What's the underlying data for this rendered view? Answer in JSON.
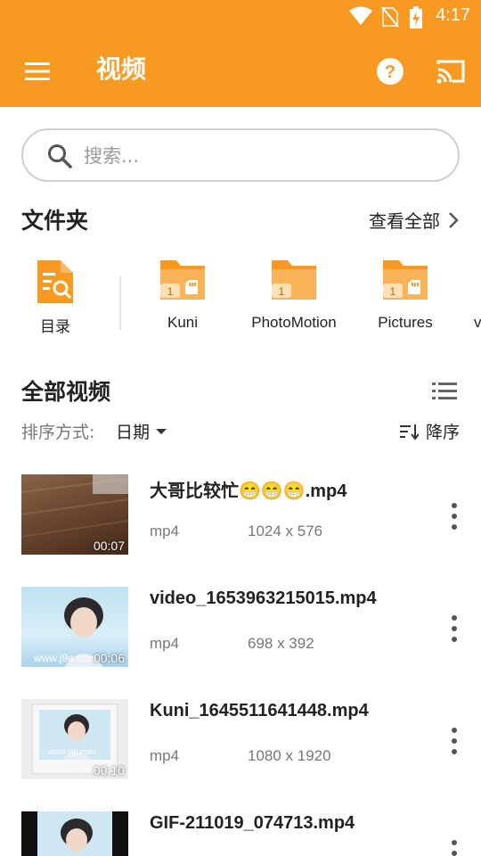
{
  "status_bar": {
    "time": "4:17"
  },
  "app_bar": {
    "title": "视频",
    "menu_icon": "menu-icon",
    "help_icon": "help-icon",
    "cast_icon": "cast-icon"
  },
  "colors": {
    "accent": "#f89a22",
    "folder": "#f89a22"
  },
  "search": {
    "placeholder": "搜索..."
  },
  "folders_section": {
    "title": "文件夹",
    "view_all": "查看全部",
    "items": [
      {
        "label": "目录",
        "icon": "directory-search-icon"
      },
      {
        "label": "Kuni",
        "icon": "sd-folder-icon",
        "badge": "1"
      },
      {
        "label": "PhotoMotion",
        "icon": "folder-icon",
        "badge": "1"
      },
      {
        "label": "Pictures",
        "icon": "sd-folder-icon",
        "badge": "1"
      },
      {
        "label": "v",
        "icon": "folder-icon"
      }
    ]
  },
  "videos_section": {
    "title": "全部视频",
    "sort_label": "排序方式:",
    "sort_value": "日期",
    "sort_order": "降序",
    "items": [
      {
        "name": "大哥比较忙😁😁😁.mp4",
        "format": "mp4",
        "resolution": "1024 x 576",
        "duration": "00:07"
      },
      {
        "name": "video_1653963215015.mp4",
        "format": "mp4",
        "resolution": "698 x 392",
        "duration": "00:06"
      },
      {
        "name": "Kuni_1645511641448.mp4",
        "format": "mp4",
        "resolution": "1080 x 1920",
        "duration": "00:10"
      },
      {
        "name": "GIF-211019_074713.mp4",
        "format": "",
        "resolution": "",
        "duration": ""
      }
    ]
  }
}
